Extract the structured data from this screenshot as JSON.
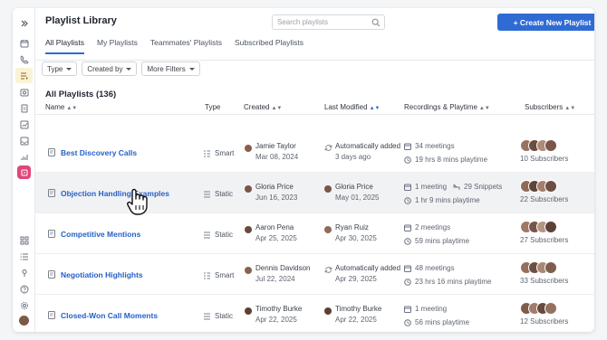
{
  "sidebar": {
    "icons": [
      "chevrons-right-icon",
      "calendar-icon",
      "phone-icon",
      "playlist-icon",
      "camera-icon",
      "document-icon",
      "chart-icon",
      "inbox-icon",
      "stats-icon",
      "app-icon",
      "grid-icon",
      "list-icon",
      "pin-icon",
      "help-icon",
      "settings-icon"
    ]
  },
  "header": {
    "title": "Playlist Library",
    "search_placeholder": "Search playlists",
    "new_button_label": "+ Create New Playlist",
    "tabs": [
      "All Playlists",
      "My Playlists",
      "Teammates' Playlists",
      "Subscribed Playlists"
    ]
  },
  "filters": [
    "Type",
    "Created by",
    "More Filters"
  ],
  "section_title": "All Playlists (136)",
  "columns": {
    "name": "Name",
    "type": "Type",
    "created": "Created",
    "modified": "Last Modified",
    "recordings": "Recordings & Playtime",
    "subscribers": "Subscribers"
  },
  "rows": [
    {
      "name": "Best Discovery Calls",
      "type": "Smart",
      "created_by": "Jamie Taylor",
      "created_date": "Mar 08, 2024",
      "modified_by": "Automatically added",
      "modified_date": "3 days ago",
      "meetings": "34 meetings",
      "playtime": "19 hrs 8 mins playtime",
      "snippets": "",
      "subscribers": "10 Subscribers"
    },
    {
      "name": "Objection Handling Examples",
      "type": "Static",
      "created_by": "Gloria Price",
      "created_date": "Jun 16, 2023",
      "modified_by": "Gloria Price",
      "modified_date": "May 01, 2025",
      "meetings": "1 meeting",
      "playtime": "1 hr 9 mins playtime",
      "snippets": "29 Snippets",
      "subscribers": "22 Subscribers"
    },
    {
      "name": "Competitive Mentions",
      "type": "Static",
      "created_by": "Aaron Pena",
      "created_date": "Apr 25, 2025",
      "modified_by": "Ryan Ruiz",
      "modified_date": "Apr 30, 2025",
      "meetings": "2 meetings",
      "playtime": "59 mins playtime",
      "snippets": "",
      "subscribers": "27 Subscribers"
    },
    {
      "name": "Negotiation Highlights",
      "type": "Smart",
      "created_by": "Dennis Davidson",
      "created_date": "Jul 22, 2024",
      "modified_by": "Automatically added",
      "modified_date": "Apr 29, 2025",
      "meetings": "48 meetings",
      "playtime": "23 hrs 16 mins playtime",
      "snippets": "",
      "subscribers": "33 Subscribers"
    },
    {
      "name": "Closed-Won Call Moments",
      "type": "Static",
      "created_by": "Timothy Burke",
      "created_date": "Apr 22, 2025",
      "modified_by": "Timothy Burke",
      "modified_date": "Apr 22, 2025",
      "meetings": "1 meeting",
      "playtime": "56 mins playtime",
      "snippets": "",
      "subscribers": "12 Subscribers"
    }
  ],
  "colors": {
    "accent": "#2f6bd3",
    "link": "#2560c7",
    "app_badge": "#e0457b",
    "active_nav": "#fbf2d5"
  }
}
